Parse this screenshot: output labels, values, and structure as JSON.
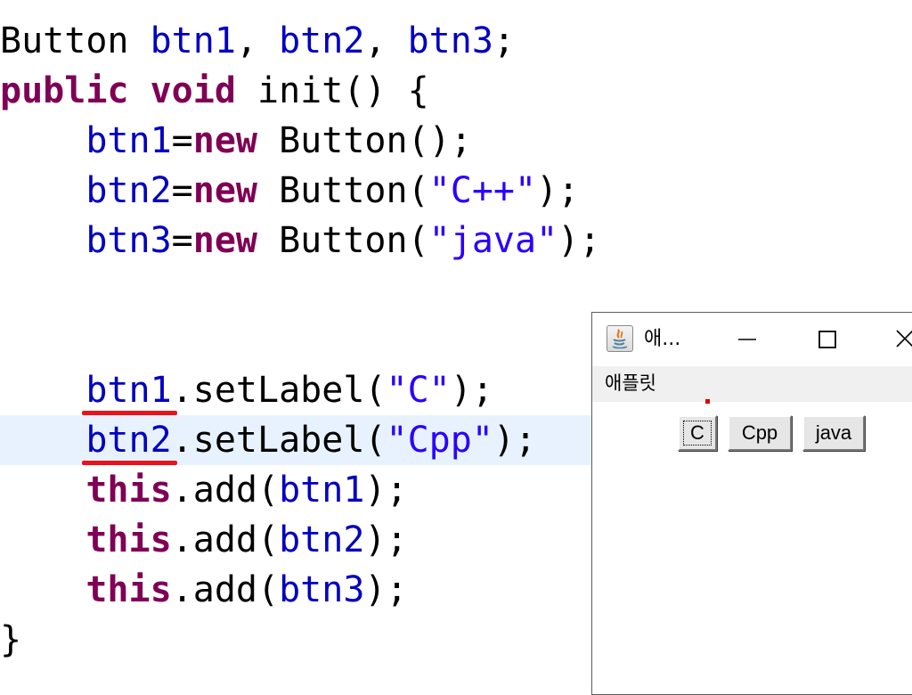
{
  "code": {
    "lines": {
      "l1": {
        "t1": "Button ",
        "f1": "btn1",
        "t2": ", ",
        "f2": "btn2",
        "t3": ", ",
        "f3": "btn3",
        "t4": ";"
      },
      "l2": {
        "k1": "public",
        "t1": " ",
        "k2": "void",
        "t2": " init() {"
      },
      "l3": {
        "indent": "    ",
        "f1": "btn1",
        "t1": "=",
        "k1": "new",
        "t2": " Button();"
      },
      "l4": {
        "indent": "    ",
        "f1": "btn2",
        "t1": "=",
        "k1": "new",
        "t2": " Button(",
        "s1": "\"C++\"",
        "t3": ");"
      },
      "l5": {
        "indent": "    ",
        "f1": "btn3",
        "t1": "=",
        "k1": "new",
        "t2": " Button(",
        "s1": "\"java\"",
        "t3": ");"
      },
      "l6": {
        "indent": "    ",
        "f1": "btn1",
        "t1": ".setLabel(",
        "s1": "\"C\"",
        "t2": ");"
      },
      "l7": {
        "indent": "    ",
        "f1": "btn2",
        "t1": ".setLabel(",
        "s1": "\"Cpp\"",
        "t2": ");"
      },
      "l8": {
        "indent": "    ",
        "k1": "this",
        "t1": ".add(",
        "f1": "btn1",
        "t2": ");"
      },
      "l9": {
        "indent": "    ",
        "k1": "this",
        "t1": ".add(",
        "f1": "btn2",
        "t2": ");"
      },
      "l10": {
        "indent": "    ",
        "k1": "this",
        "t1": ".add(",
        "f1": "btn3",
        "t2": ");"
      },
      "l11": {
        "t1": "}"
      }
    }
  },
  "applet": {
    "title": "애...",
    "status": "애플릿",
    "buttons": {
      "c": "C",
      "cpp": "Cpp",
      "java": "java"
    },
    "icons": {
      "app": "java-icon",
      "minimize": "minimize-icon",
      "maximize": "maximize-icon",
      "close": "close-icon"
    }
  },
  "colors": {
    "keyword": "#7f0055",
    "field": "#0000c0",
    "string": "#2a00ff",
    "highlight_line": "#e8f2fe",
    "error_underline": "#e8131b",
    "status_bar": "#f0f0f0"
  }
}
